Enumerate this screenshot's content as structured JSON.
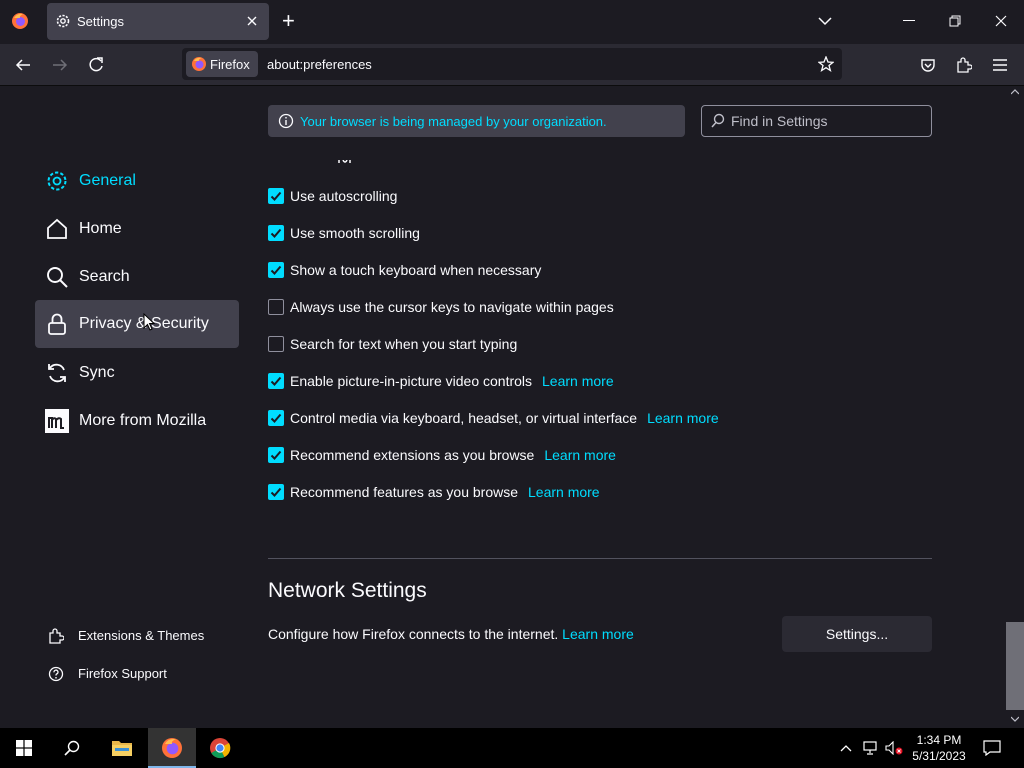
{
  "window": {
    "tab_title": "Settings",
    "new_tab_label": "+"
  },
  "nav": {
    "identity_label": "Firefox",
    "url": "about:preferences"
  },
  "notice": {
    "text": "Your browser is being managed by your organization."
  },
  "search": {
    "placeholder": "Find in Settings"
  },
  "sidebar": {
    "categories": [
      {
        "label": "General",
        "icon": "gear-icon"
      },
      {
        "label": "Home",
        "icon": "home-icon"
      },
      {
        "label": "Search",
        "icon": "search-icon"
      },
      {
        "label": "Privacy & Security",
        "icon": "lock-icon"
      },
      {
        "label": "Sync",
        "icon": "sync-icon"
      },
      {
        "label": "More from Mozilla",
        "icon": "mozilla-icon"
      }
    ],
    "footer": [
      {
        "label": "Extensions & Themes",
        "icon": "puzzle-icon"
      },
      {
        "label": "Firefox Support",
        "icon": "help-icon"
      }
    ]
  },
  "browsing": {
    "options": [
      {
        "label": "Use autoscrolling",
        "checked": true
      },
      {
        "label": "Use smooth scrolling",
        "checked": true
      },
      {
        "label": "Show a touch keyboard when necessary",
        "checked": true
      },
      {
        "label": "Always use the cursor keys to navigate within pages",
        "checked": false
      },
      {
        "label": "Search for text when you start typing",
        "checked": false
      },
      {
        "label": "Enable picture-in-picture video controls",
        "checked": true,
        "learn_more": "Learn more"
      },
      {
        "label": "Control media via keyboard, headset, or virtual interface",
        "checked": true,
        "learn_more": "Learn more"
      },
      {
        "label": "Recommend extensions as you browse",
        "checked": true,
        "learn_more": "Learn more"
      },
      {
        "label": "Recommend features as you browse",
        "checked": true,
        "learn_more": "Learn more"
      }
    ]
  },
  "network": {
    "title": "Network Settings",
    "description": "Configure how Firefox connects to the internet.",
    "learn_more": "Learn more",
    "button_label": "Settings..."
  },
  "taskbar": {
    "time": "1:34 PM",
    "date": "5/31/2023"
  },
  "colors": {
    "accent": "#00ddff",
    "background": "#1c1b22",
    "toolbar": "#2b2a33"
  }
}
